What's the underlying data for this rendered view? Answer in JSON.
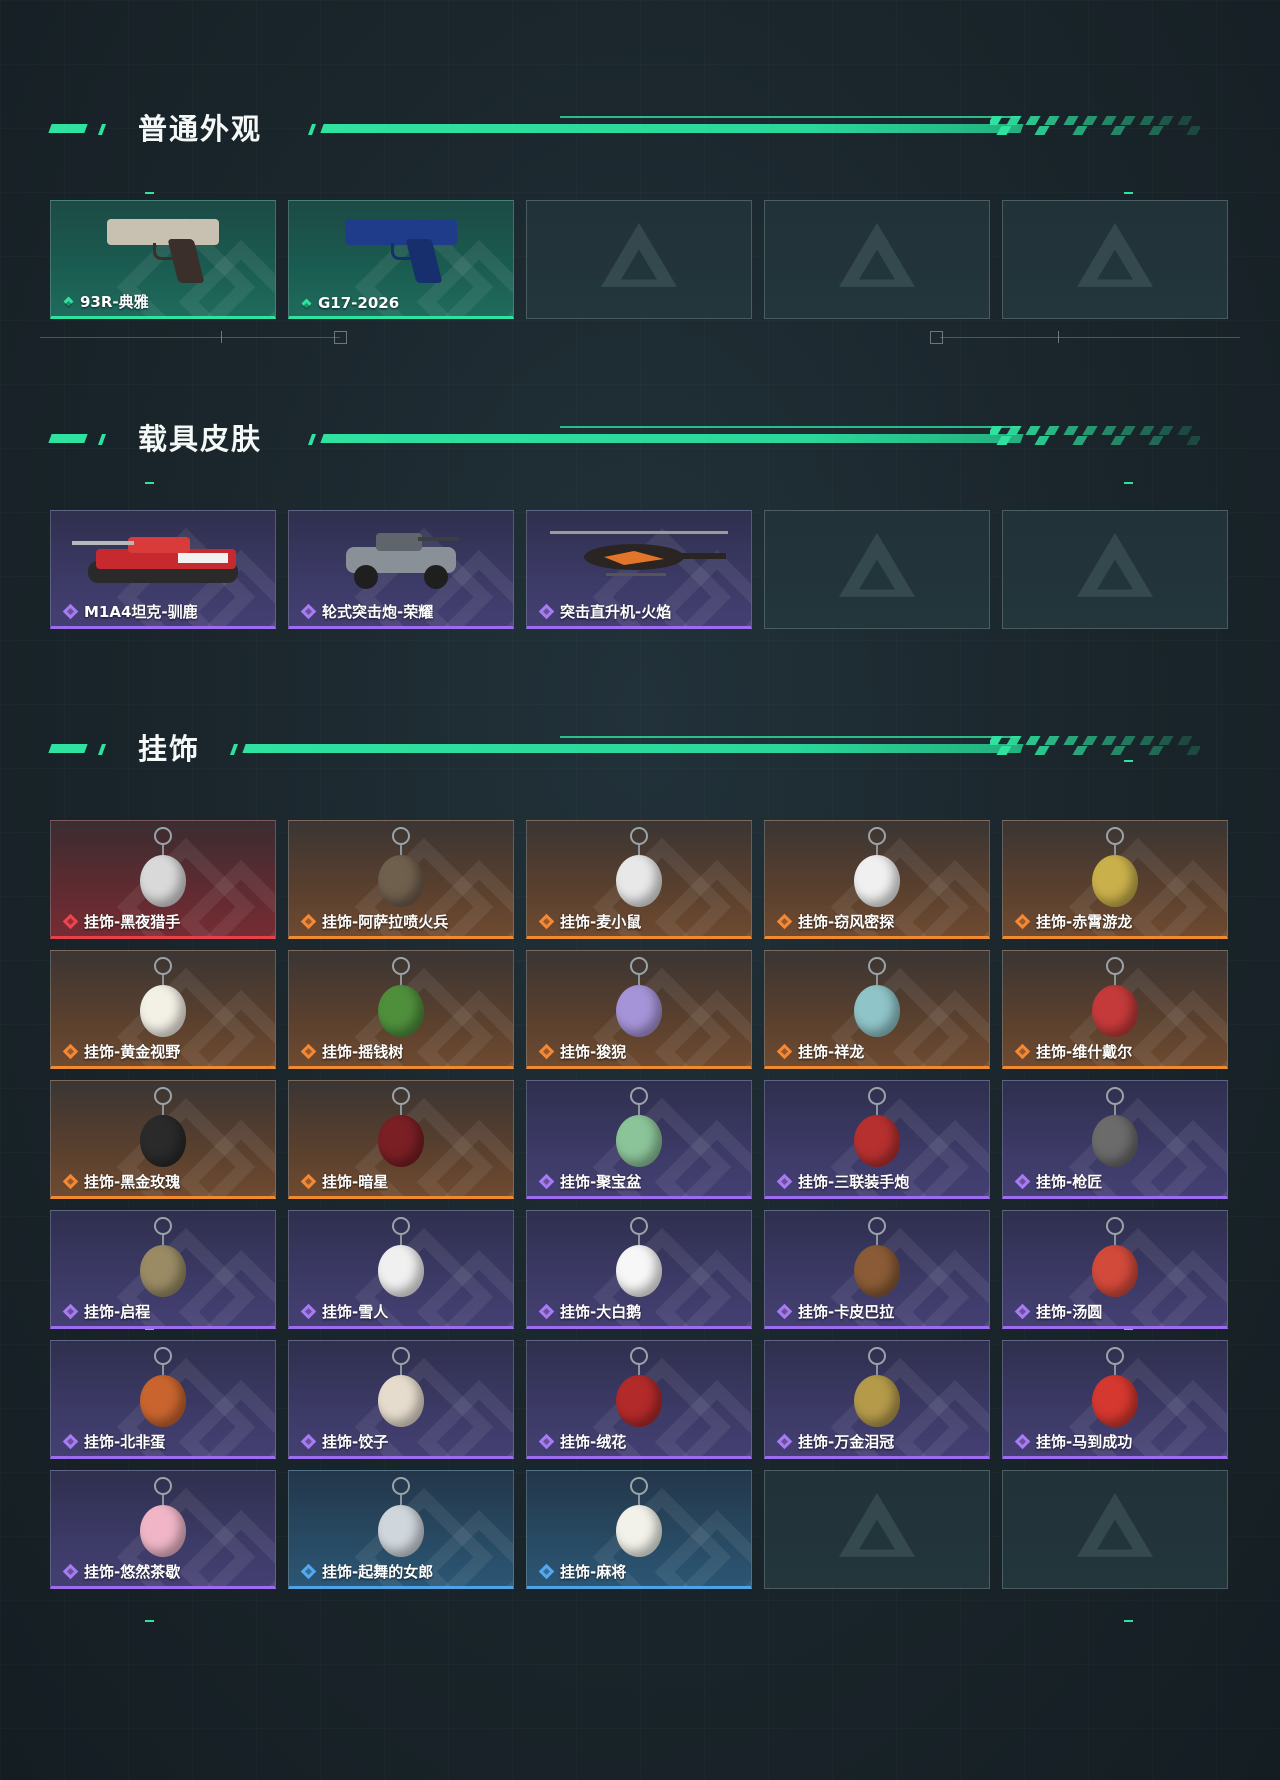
{
  "sections": {
    "normal": {
      "title": "普通外观",
      "items": [
        {
          "name": "93R-典雅",
          "rarity": "green",
          "icon": "pistol-silver"
        },
        {
          "name": "G17-2026",
          "rarity": "green",
          "icon": "pistol-blue"
        }
      ]
    },
    "vehicle": {
      "title": "载具皮肤",
      "items": [
        {
          "name": "M1A4坦克-驯鹿",
          "rarity": "purple",
          "icon": "tank"
        },
        {
          "name": "轮式突击炮-荣耀",
          "rarity": "purple",
          "icon": "armored-car"
        },
        {
          "name": "突击直升机-火焰",
          "rarity": "purple",
          "icon": "helicopter"
        }
      ]
    },
    "charms": {
      "title": "挂饰",
      "items": [
        {
          "name": "挂饰-黑夜猎手",
          "rarity": "red",
          "icon": "charm-white-figure",
          "color": "#d9d9d9"
        },
        {
          "name": "挂饰-阿萨拉喷火兵",
          "rarity": "orange",
          "icon": "charm-soldier",
          "color": "#6f5f4d"
        },
        {
          "name": "挂饰-麦小鼠",
          "rarity": "orange",
          "icon": "charm-mouse",
          "color": "#e8e8e8"
        },
        {
          "name": "挂饰-窃风密探",
          "rarity": "orange",
          "icon": "charm-white-figure",
          "color": "#f0f0f0"
        },
        {
          "name": "挂饰-赤霄游龙",
          "rarity": "orange",
          "icon": "charm-gold-figure",
          "color": "#c9b04a"
        },
        {
          "name": "挂饰-黄金视野",
          "rarity": "orange",
          "icon": "charm-cat",
          "color": "#f3f0e6"
        },
        {
          "name": "挂饰-摇钱树",
          "rarity": "orange",
          "icon": "charm-tree",
          "color": "#4f8f3c"
        },
        {
          "name": "挂饰-狻猊",
          "rarity": "orange",
          "icon": "charm-lion",
          "color": "#a694d8"
        },
        {
          "name": "挂饰-祥龙",
          "rarity": "orange",
          "icon": "charm-dragon",
          "color": "#8fc4c8"
        },
        {
          "name": "挂饰-维什戴尔",
          "rarity": "orange",
          "icon": "charm-card",
          "color": "#c43a3a"
        },
        {
          "name": "挂饰-黑金玫瑰",
          "rarity": "orange",
          "icon": "charm-black-rose",
          "color": "#2a2a2a"
        },
        {
          "name": "挂饰-暗星",
          "rarity": "orange",
          "icon": "charm-feather",
          "color": "#7a1f24"
        },
        {
          "name": "挂饰-聚宝盆",
          "rarity": "purple",
          "icon": "charm-bowl",
          "color": "#8cc49a"
        },
        {
          "name": "挂饰-三联装手炮",
          "rarity": "purple",
          "icon": "charm-launcher",
          "color": "#b73030"
        },
        {
          "name": "挂饰-枪匠",
          "rarity": "purple",
          "icon": "charm-gear",
          "color": "#6b6b6b"
        },
        {
          "name": "挂饰-启程",
          "rarity": "purple",
          "icon": "charm-ring-badge",
          "color": "#9a8b65"
        },
        {
          "name": "挂饰-雪人",
          "rarity": "purple",
          "icon": "charm-snowman",
          "color": "#f0f0f0"
        },
        {
          "name": "挂饰-大白鹅",
          "rarity": "purple",
          "icon": "charm-goose",
          "color": "#f7f7f7"
        },
        {
          "name": "挂饰-卡皮巴拉",
          "rarity": "purple",
          "icon": "charm-capybara",
          "color": "#8a5b36"
        },
        {
          "name": "挂饰-汤圆",
          "rarity": "purple",
          "icon": "charm-tangyuan",
          "color": "#d24a3a"
        },
        {
          "name": "挂饰-北非蛋",
          "rarity": "purple",
          "icon": "charm-shakshuka",
          "color": "#c9642f"
        },
        {
          "name": "挂饰-饺子",
          "rarity": "purple",
          "icon": "charm-dumpling",
          "color": "#e6dccd"
        },
        {
          "name": "挂饰-绒花",
          "rarity": "purple",
          "icon": "charm-flower",
          "color": "#b32a2a"
        },
        {
          "name": "挂饰-万金泪冠",
          "rarity": "purple",
          "icon": "charm-crown",
          "color": "#b59a4a"
        },
        {
          "name": "挂饰-马到成功",
          "rarity": "purple",
          "icon": "charm-horse",
          "color": "#d5382f"
        },
        {
          "name": "挂饰-悠然茶歇",
          "rarity": "purple",
          "icon": "charm-cupcake",
          "color": "#f0b6c8"
        },
        {
          "name": "挂饰-起舞的女郎",
          "rarity": "blue",
          "icon": "charm-dancer",
          "color": "#cfd6dc"
        },
        {
          "name": "挂饰-麻将",
          "rarity": "blue",
          "icon": "charm-mahjong",
          "color": "#f2f2ea"
        }
      ]
    }
  },
  "colors": {
    "accent": "#2fe2a0",
    "green": "#2fe2a0",
    "purple": "#9d6bf0",
    "orange": "#ef8a2e",
    "red": "#e8404a",
    "blue": "#4ea3e8"
  }
}
